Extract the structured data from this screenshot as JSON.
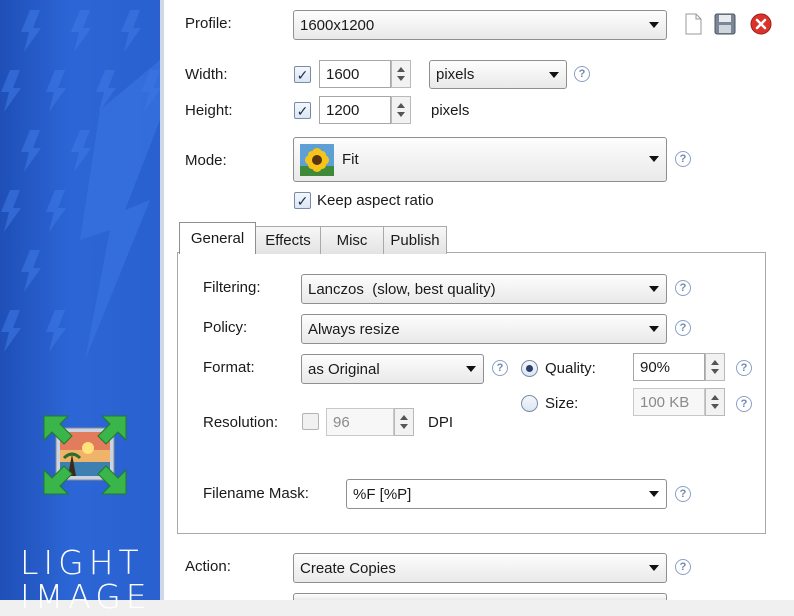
{
  "brand": {
    "line1": "LIGHT",
    "line2": "IMAGE"
  },
  "profile": {
    "label": "Profile:",
    "value": "1600x1200"
  },
  "width": {
    "label": "Width:",
    "checked": true,
    "value": "1600",
    "unit": "pixels"
  },
  "height": {
    "label": "Height:",
    "checked": true,
    "value": "1200",
    "unit": "pixels"
  },
  "mode": {
    "label": "Mode:",
    "value": "Fit",
    "icon": "sunflower-icon"
  },
  "keep_aspect": {
    "label": "Keep aspect ratio",
    "checked": true
  },
  "tabs": [
    {
      "label": "General",
      "active": true
    },
    {
      "label": "Effects",
      "active": false
    },
    {
      "label": "Misc",
      "active": false
    },
    {
      "label": "Publish",
      "active": false
    }
  ],
  "general": {
    "filtering": {
      "label": "Filtering:",
      "value": "Lanczos  (slow, best quality)"
    },
    "policy": {
      "label": "Policy:",
      "value": "Always resize"
    },
    "format": {
      "label": "Format:",
      "value": "as Original"
    },
    "quality": {
      "label": "Quality:",
      "value": "90%",
      "selected": true
    },
    "size": {
      "label": "Size:",
      "value": "100 KB",
      "selected": false
    },
    "resolution": {
      "label": "Resolution:",
      "value": "96",
      "unit": "DPI",
      "checked": false
    },
    "filename_mask": {
      "label": "Filename Mask:",
      "value": "%F [%P]"
    }
  },
  "action": {
    "label": "Action:",
    "value": "Create Copies"
  },
  "help_glyph": "?",
  "check_glyph": "✓",
  "colors": {
    "sidebar": "#2a60cf",
    "close": "#d9332b"
  }
}
